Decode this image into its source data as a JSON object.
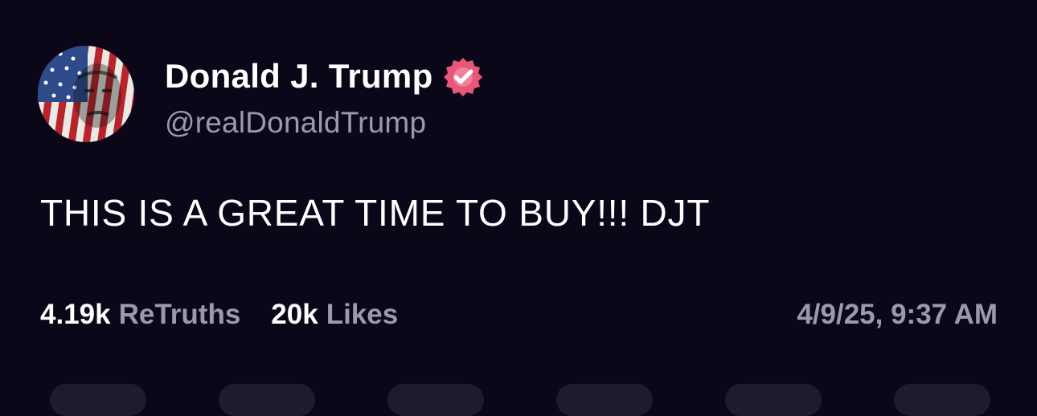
{
  "author": {
    "display_name": "Donald J. Trump",
    "handle": "@realDonaldTrump",
    "verified_badge_color": "#e8577a",
    "avatar_icon": "profile-avatar-flag-portrait"
  },
  "post": {
    "text": "THIS IS A GREAT TIME TO BUY!!! DJT"
  },
  "stats": {
    "retruths_count": "4.19k",
    "retruths_label": "ReTruths",
    "likes_count": "20k",
    "likes_label": "Likes"
  },
  "timestamp": "4/9/25, 9:37 AM",
  "colors": {
    "background": "#0b0718",
    "primary_text": "#ffffff",
    "secondary_text": "#9d98b0"
  }
}
